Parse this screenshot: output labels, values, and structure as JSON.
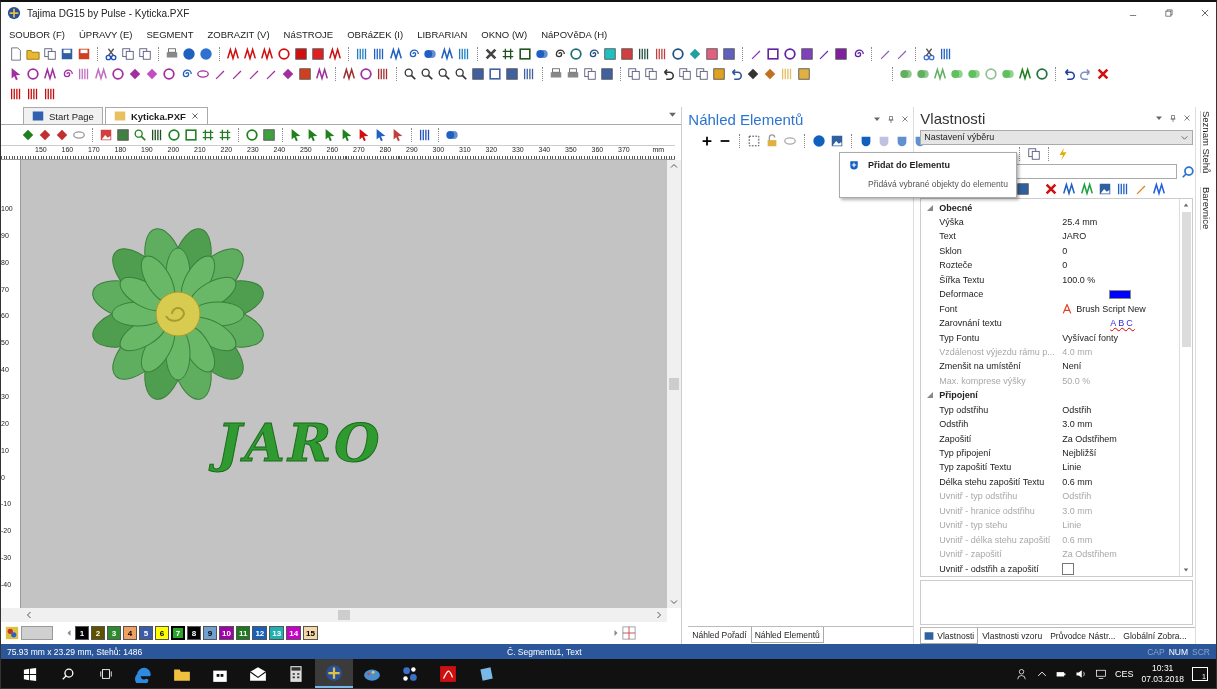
{
  "window": {
    "title": "Tajima DG15 by Pulse - Kyticka.PXF"
  },
  "menu": [
    "SOUBOR (F)",
    "ÚPRAVY (E)",
    "SEGMENT",
    "ZOBRAZIT (V)",
    "NáSTROJE",
    "OBRáZEK (I)",
    "LIBRARIAN",
    "OKNO (W)",
    "NáPOVěDA (H)"
  ],
  "document_tabs": [
    {
      "label": "Start Page",
      "selected": false
    },
    {
      "label": "Kyticka.PXF",
      "selected": true
    }
  ],
  "ruler": {
    "ticks": [
      "150",
      "160",
      "170",
      "180",
      "190",
      "200",
      "210",
      "220",
      "230",
      "240",
      "250",
      "260",
      "270",
      "280",
      "290",
      "300",
      "310",
      "320",
      "330",
      "340",
      "350",
      "360",
      "370"
    ],
    "unit": "mm"
  },
  "vertical_ruler": {
    "ticks": [
      "100",
      "90",
      "80",
      "70",
      "60",
      "50",
      "40",
      "30",
      "20",
      "10",
      "0",
      "-10",
      "-20",
      "-30",
      "-40"
    ]
  },
  "design": {
    "text": "JARO"
  },
  "palette": [
    {
      "label": "1",
      "color": "#000000",
      "selected": false
    },
    {
      "label": "2",
      "color": "#5c5200",
      "selected": false
    },
    {
      "label": "3",
      "color": "#2f8a2f",
      "selected": false
    },
    {
      "label": "4",
      "color": "#f0a060",
      "selected": false
    },
    {
      "label": "5",
      "color": "#3c5ca8",
      "selected": false
    },
    {
      "label": "6",
      "color": "#ffff00",
      "selected": false
    },
    {
      "label": "7",
      "color": "#2aa52a",
      "selected": true
    },
    {
      "label": "8",
      "color": "#000000",
      "selected": false
    },
    {
      "label": "9",
      "color": "#6fa0d0",
      "selected": false
    },
    {
      "label": "10",
      "color": "#a000a8",
      "selected": false
    },
    {
      "label": "11",
      "color": "#1f7a1f",
      "selected": false
    },
    {
      "label": "12",
      "color": "#1860b8",
      "selected": false
    },
    {
      "label": "13",
      "color": "#20b0b0",
      "selected": false
    },
    {
      "label": "14",
      "color": "#c800c8",
      "selected": false
    },
    {
      "label": "15",
      "color": "#f4d8a8",
      "selected": false
    }
  ],
  "element_panel": {
    "title": "Náhled Elementů",
    "tooltip": {
      "title": "Přidat do Elementu",
      "description": "Přidává vybrané objekty do elementu"
    },
    "tabs": [
      {
        "label": "Náhled Pořadí",
        "selected": false
      },
      {
        "label": "Náhled Elementů",
        "selected": true
      }
    ]
  },
  "properties_panel": {
    "title": "Vlastnosti",
    "selector": "Nastavení výběru",
    "categories": [
      {
        "name": "Obecné",
        "expanded": true,
        "rows": [
          {
            "kind": "text",
            "name": "Výška",
            "value": "25.4 mm",
            "disabled": false
          },
          {
            "kind": "text",
            "name": "Text",
            "value": "JARO",
            "disabled": false
          },
          {
            "kind": "text",
            "name": "Sklon",
            "value": "0",
            "disabled": false
          },
          {
            "kind": "text",
            "name": "Rozteče",
            "value": "0",
            "disabled": false
          },
          {
            "kind": "text",
            "name": "Šířka Textu",
            "value": "100.0 %",
            "disabled": false
          },
          {
            "kind": "color",
            "name": "Deformace",
            "color": "#0000ff",
            "disabled": false
          },
          {
            "kind": "font",
            "name": "Font",
            "value": "Brush Script New",
            "disabled": false
          },
          {
            "kind": "alignment",
            "name": "Zarovnání textu",
            "value": "ABC",
            "disabled": false
          },
          {
            "kind": "text",
            "name": "Typ Fontu",
            "value": "Vyšívací fonty",
            "disabled": false
          },
          {
            "kind": "text",
            "name": "Vzdálenost výjezdu rámu p...",
            "value": "4.0 mm",
            "disabled": true
          },
          {
            "kind": "text",
            "name": "Zmenšit na umístění",
            "value": "Není",
            "disabled": false
          },
          {
            "kind": "text",
            "name": "Max. komprese výšky",
            "value": "50.0 %",
            "disabled": true
          }
        ]
      },
      {
        "name": "Připojení",
        "expanded": true,
        "rows": [
          {
            "kind": "text",
            "name": "Typ odstřihu",
            "value": "Odstřih",
            "disabled": false
          },
          {
            "kind": "text",
            "name": "Odstřih",
            "value": "3.0 mm",
            "disabled": false
          },
          {
            "kind": "text",
            "name": "Zapošití",
            "value": "Za Odstřihem",
            "disabled": false
          },
          {
            "kind": "text",
            "name": "Typ připojení",
            "value": "Nejbližší",
            "disabled": false
          },
          {
            "kind": "text",
            "name": "Typ zapošití Textu",
            "value": "Linie",
            "disabled": false
          },
          {
            "kind": "text",
            "name": "Délka stehu zapošití Textu",
            "value": "0.6 mm",
            "disabled": false
          },
          {
            "kind": "text",
            "name": "Uvnitř - typ odstřihu",
            "value": "Odstřih",
            "disabled": true
          },
          {
            "kind": "text",
            "name": "Uvnitř - hranice odstřihu",
            "value": "3.0 mm",
            "disabled": true
          },
          {
            "kind": "text",
            "name": "Uvnitř - typ stehu",
            "value": "Linie",
            "disabled": true
          },
          {
            "kind": "text",
            "name": "Uvnitř - délka stehu zapošití",
            "value": "0.6 mm",
            "disabled": true
          },
          {
            "kind": "text",
            "name": "Uvnitř - zapošití",
            "value": "Za Odstřihem",
            "disabled": true
          },
          {
            "kind": "checkbox",
            "name": "Uvnitř - odstřih a zapošití",
            "checked": false,
            "disabled": false
          }
        ]
      }
    ],
    "tabs": [
      {
        "label": "Vlastnosti",
        "selected": true
      },
      {
        "label": "Vlastnosti vzoru",
        "selected": false
      },
      {
        "label": "Průvodce Nástr...",
        "selected": false
      },
      {
        "label": "Globální Zobra...",
        "selected": false
      }
    ]
  },
  "side_tabs": [
    "Seznam Stehů",
    "Barevnice"
  ],
  "status_bar": {
    "size": "75.93 mm x 23.29 mm, Stehů: 1486",
    "segment": "Č. Segmentu1, Text",
    "indicators": [
      {
        "label": "CAP",
        "on": false
      },
      {
        "label": "NUM",
        "on": true
      },
      {
        "label": "SCR",
        "on": false
      }
    ]
  },
  "taskbar": {
    "language": "CES",
    "time": "10:31",
    "date": "07.03.2018",
    "notifications": "1"
  }
}
